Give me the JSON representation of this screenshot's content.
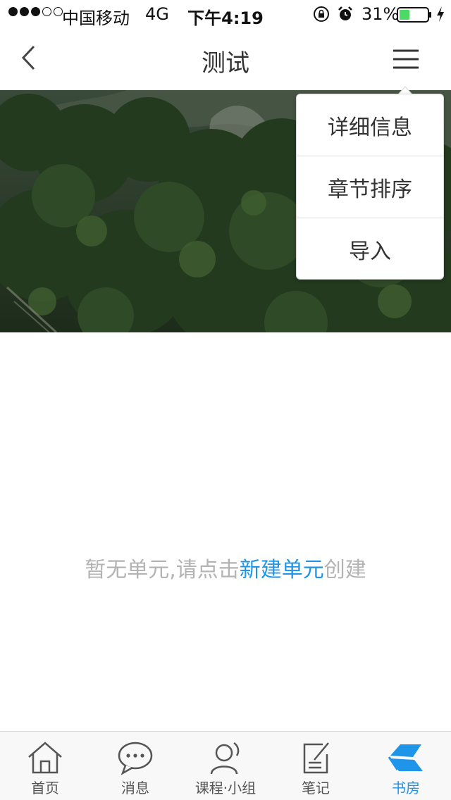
{
  "status_bar": {
    "carrier": "中国移动",
    "network": "4G",
    "time": "下午4:19",
    "battery": "31%",
    "signal_bars_filled": 3,
    "signal_bars_total": 5
  },
  "nav": {
    "title": "测试",
    "back_icon": "chevron-left-icon",
    "menu_icon": "hamburger-menu-icon"
  },
  "dropdown": {
    "items": [
      {
        "label": "详细信息"
      },
      {
        "label": "章节排序"
      },
      {
        "label": "导入"
      }
    ]
  },
  "empty_state": {
    "prefix": "暂无单元,请点击",
    "link": "新建单元",
    "suffix": "创建"
  },
  "tabs": [
    {
      "label": "首页",
      "icon": "home-icon"
    },
    {
      "label": "消息",
      "icon": "message-bubble-icon"
    },
    {
      "label": "课程·小组",
      "icon": "user-group-icon"
    },
    {
      "label": "笔记",
      "icon": "note-icon"
    },
    {
      "label": "书房",
      "icon": "study-book-icon",
      "active": true
    }
  ],
  "colors": {
    "accent": "#1e95e8",
    "battery_fill": "#4cd964",
    "hint_text": "#b3b3b3"
  }
}
